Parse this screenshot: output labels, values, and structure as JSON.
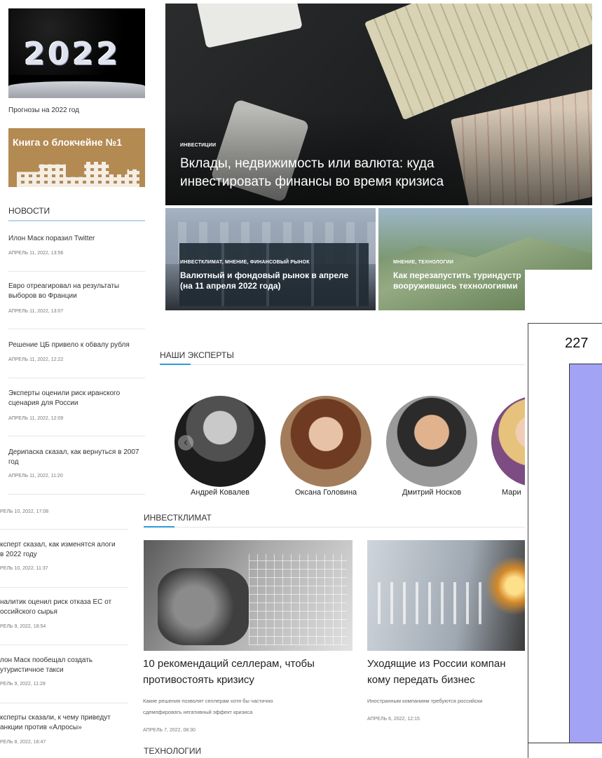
{
  "sidebar": {
    "promo_2022": {
      "image_text": "2022",
      "caption": "Прогнозы на 2022 год"
    },
    "promo_book": {
      "image_text": "Книга о блокчейне №1"
    },
    "news_header": "НОВОСТИ",
    "news": [
      {
        "title": "Илон Маск поразил Twitter",
        "date": "АПРЕЛЬ 11, 2022, 13:56"
      },
      {
        "title": "Евро отреагировал на результаты выборов во Франции",
        "date": "АПРЕЛЬ 11, 2022, 13:07"
      },
      {
        "title": "Решение ЦБ привело к обвалу рубля",
        "date": "АПРЕЛЬ 11, 2022, 12:22"
      },
      {
        "title": "Эксперты оценили риск иранского сценария для России",
        "date": "АПРЕЛЬ 11, 2022, 12:09"
      },
      {
        "title": "Дерипаска сказал, как вернуться в 2007 год",
        "date": "АПРЕЛЬ 11, 2022, 11:20"
      }
    ],
    "news_cut": [
      {
        "title": "",
        "date": "РЕЛЬ 10, 2022, 17:08"
      },
      {
        "title": "ксперт сказал, как изменятся алоги в 2022 году",
        "date": "РЕЛЬ 10, 2022, 11:37"
      },
      {
        "title": "налитик оценил риск отказа ЕС от оссийского сырья",
        "date": "РЕЛЬ 9, 2022, 18:54"
      },
      {
        "title": "лон Маск пообещал создать утуристичное такси",
        "date": "РЕЛЬ 9, 2022, 11:28"
      },
      {
        "title": "ксперты сказали, к чему приведут анкции против «Алросы»",
        "date": "РЕЛЬ 8, 2022, 16:47"
      }
    ]
  },
  "hero": {
    "tag": "ИНВЕСТИЦИИ",
    "title_line1": "Вклады, недвижимость или валюта: куда",
    "title_line2": "инвестировать финансы во время кризиса"
  },
  "sub_left": {
    "tag": "ИНВЕСТКЛИМАТ, МНЕНИЕ, ФИНАНСОВЫЙ РЫНОК",
    "title_line1": "Валютный и фондовый рынок в апреле",
    "title_line2": "(на 11 апреля 2022 года)"
  },
  "sub_right": {
    "tag": "МНЕНИЕ, ТЕХНОЛОГИИ",
    "title_line1": "Как перезапустить туриндустр",
    "title_line2": "вооружившись технологиями"
  },
  "experts": {
    "header": "НАШИ ЭКСПЕРТЫ",
    "prev_icon": "‹",
    "names": [
      "Андрей Ковалев",
      "Оксана Головина",
      "Дмитрий Носков",
      "Мари"
    ]
  },
  "investclimate": {
    "header": "ИНВЕСТКЛИМАТ",
    "cards": [
      {
        "title_line1": "10 рекомендаций селлерам, чтобы",
        "title_line2": "противостоять кризису",
        "desc_line1": "Какие решения позволят селлерам хотя бы частично",
        "desc_line2": "сдемпфировать негативный эффект кризиса",
        "date": "АПРЕЛЬ 7, 2022, 08:30"
      },
      {
        "title_line1": "Уходящие из России компан",
        "title_line2": "кому передать бизнес",
        "desc_line1": "Иностранным компаниям требуются российски",
        "desc_line2": "",
        "date": "АПРЕЛЬ 6, 2022, 12:15"
      }
    ]
  },
  "tech_header": "ТЕХНОЛОГИИ",
  "overlay_number": "227",
  "colors": {
    "accent": "#2e9bd6",
    "overlay_bar": "#a3a3f5"
  }
}
